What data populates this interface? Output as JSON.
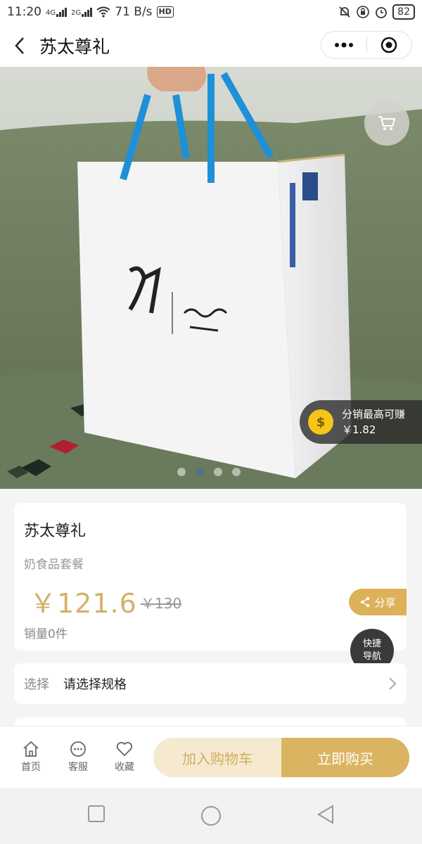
{
  "status_bar": {
    "time": "11:20",
    "net_4g": "4G",
    "net_2g": "2G",
    "speed": "71 B/s",
    "hd": "HD",
    "battery": "82"
  },
  "nav": {
    "title": "苏太尊礼",
    "more_icon": "more-dots-icon",
    "close_icon": "target-icon"
  },
  "hero": {
    "cart_icon": "cart-icon",
    "distribution": {
      "title": "分销最高可赚",
      "amount": "￥1.82",
      "icon": "money-bag-icon"
    },
    "carousel": {
      "total": 4,
      "active_index": 1
    }
  },
  "product": {
    "name": "苏太尊礼",
    "subtitle": "奶食品套餐",
    "price": "￥121.6",
    "original_price": "￥130",
    "sales": "销量0件"
  },
  "share": {
    "label": "分享",
    "icon": "share-icon"
  },
  "quick_nav": {
    "line1": "快捷",
    "line2": "导航"
  },
  "spec": {
    "label": "选择",
    "value": "请选择规格"
  },
  "bottom_bar": {
    "tabs": [
      {
        "label": "首页",
        "icon": "home-icon"
      },
      {
        "label": "客服",
        "icon": "chat-icon"
      },
      {
        "label": "收藏",
        "icon": "heart-icon"
      }
    ],
    "add_to_cart": "加入购物车",
    "buy_now": "立即购买"
  },
  "colors": {
    "accent_gold": "#dbb462",
    "price_gold": "#d4b169",
    "cart_button_bg": "#f5ead0"
  }
}
